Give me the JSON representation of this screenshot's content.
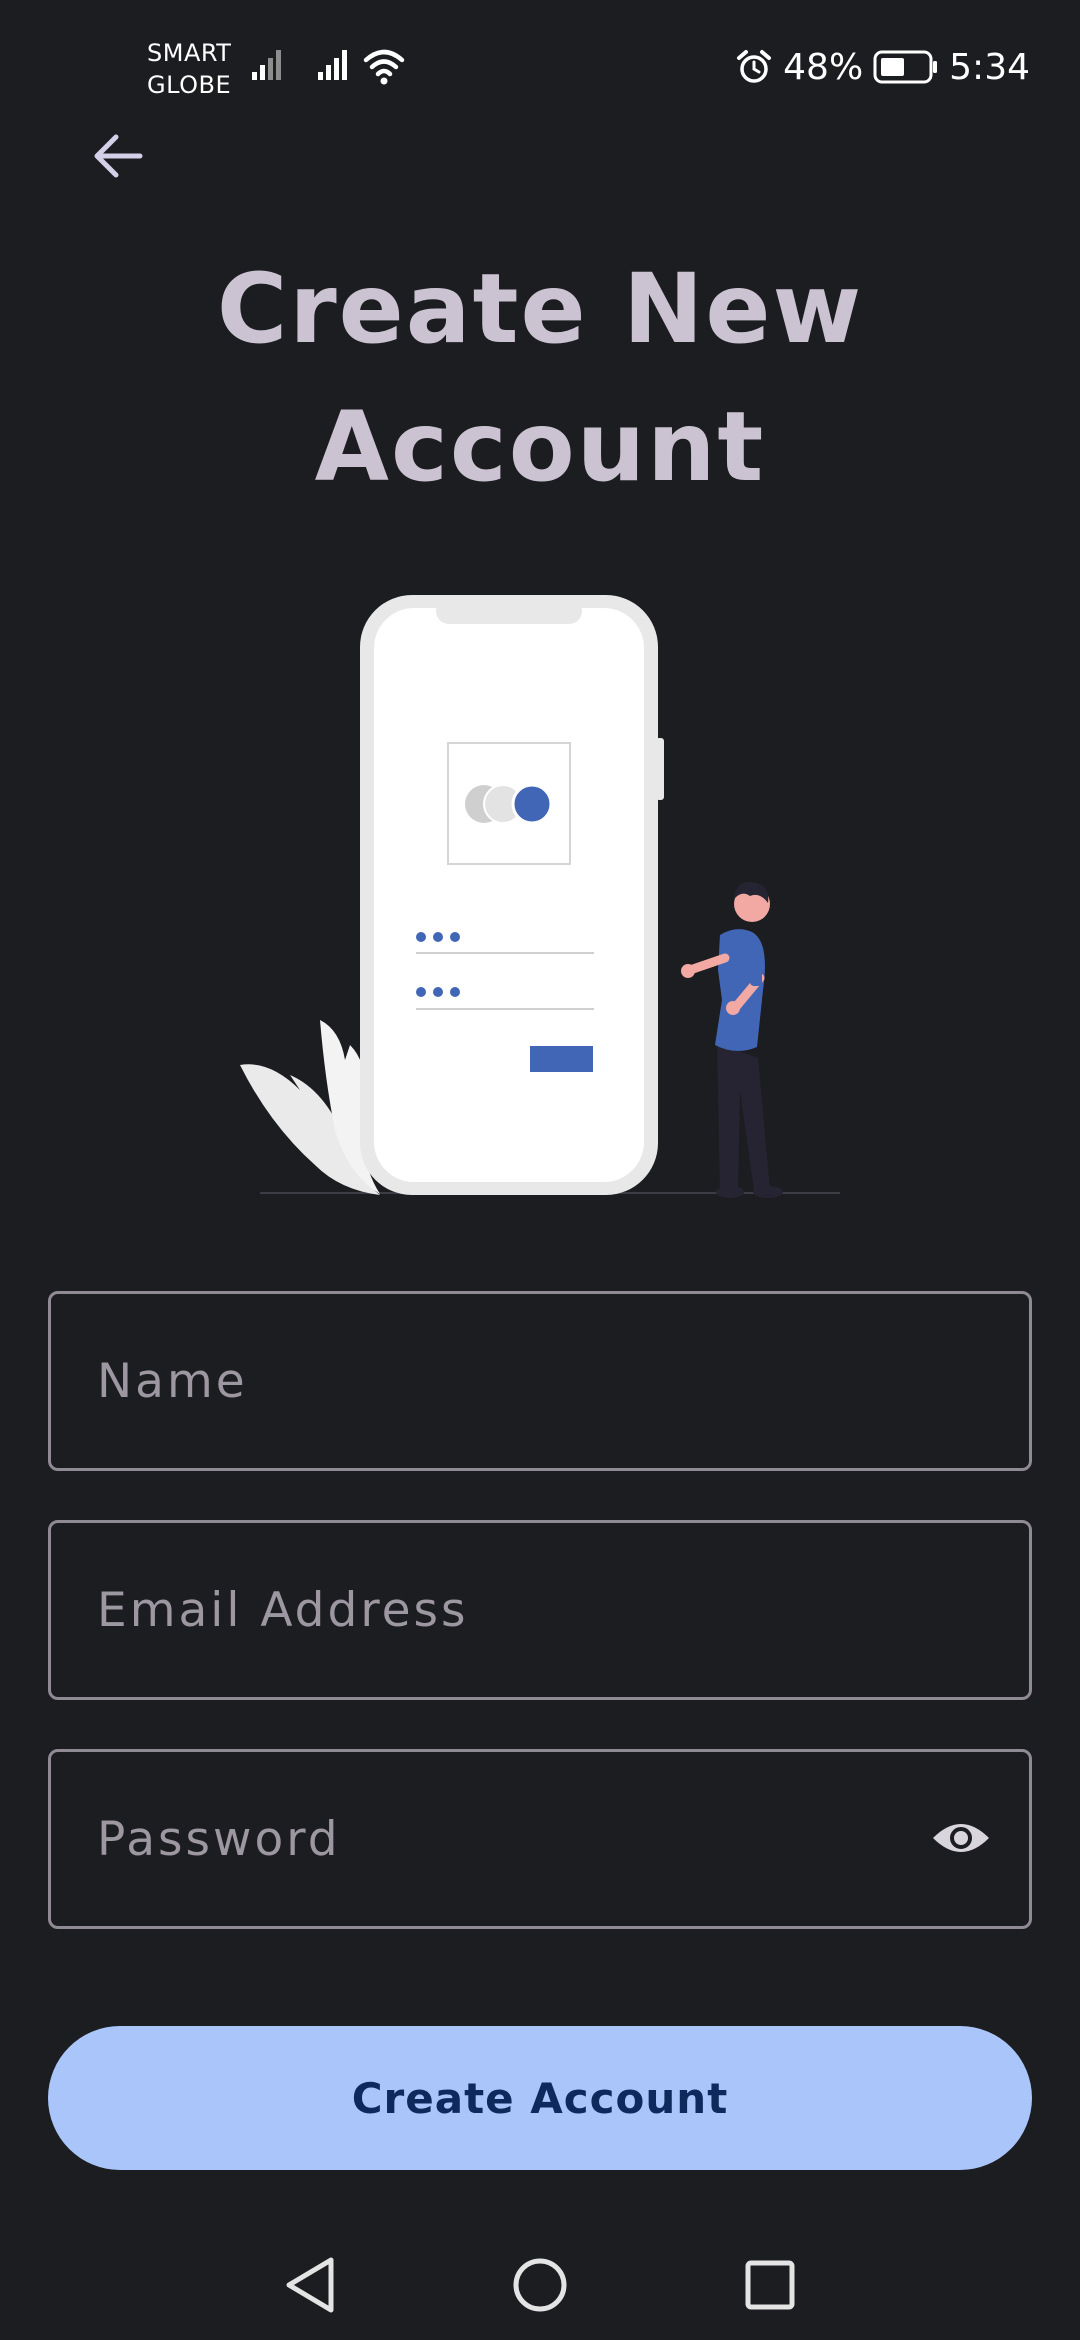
{
  "status_bar": {
    "carrier_line1": "SMART",
    "carrier_line2": "GLOBE",
    "battery_percent": "48%",
    "time": "5:34",
    "icons": [
      "signal-icon",
      "signal-icon",
      "wifi-icon",
      "alarm-icon",
      "battery-icon"
    ]
  },
  "header": {
    "back_icon": "arrow-left-icon",
    "title_line1": "Create New",
    "title_line2": "Account"
  },
  "form": {
    "name_placeholder": "Name",
    "email_placeholder": "Email Address",
    "password_placeholder": "Password",
    "password_toggle_icon": "eye-icon",
    "submit_label": "Create Account"
  },
  "nav": {
    "back_icon": "triangle-back-icon",
    "home_icon": "circle-home-icon",
    "recents_icon": "square-recents-icon"
  },
  "colors": {
    "background": "#1c1d20",
    "title": "#cbc3d1",
    "accent": "#a9c5fa",
    "accent_text": "#0e2a5c",
    "illustration_blue": "#4166b5"
  }
}
